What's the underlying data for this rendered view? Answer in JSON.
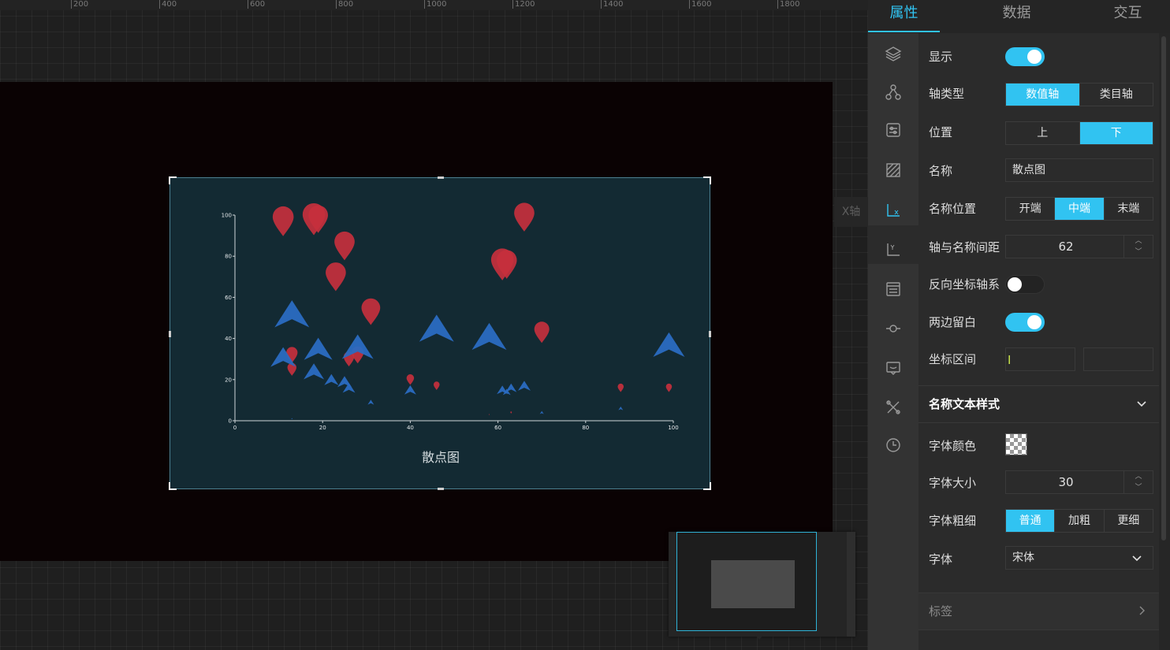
{
  "ruler": {
    "labels": [
      "200",
      "400",
      "600",
      "800",
      "1000",
      "1200",
      "1400",
      "1600",
      "1800"
    ]
  },
  "canvas": {
    "x_axis_tab_label": "X轴",
    "chart": {
      "x_axis_title": "散点图"
    }
  },
  "chart_data": {
    "type": "scatter",
    "title": "",
    "xlabel": "散点图",
    "ylabel": "",
    "xlim": [
      0,
      100
    ],
    "ylim": [
      0,
      100
    ],
    "x_ticks": [
      "0",
      "20",
      "40",
      "60",
      "80",
      "100"
    ],
    "y_ticks": [
      "0",
      "20",
      "40",
      "60",
      "80",
      "100"
    ],
    "grid": false,
    "series": [
      {
        "symbol": "pin",
        "color": "#c5303d",
        "points": [
          {
            "x": 11,
            "y": 97,
            "size": 28
          },
          {
            "x": 18,
            "y": 98,
            "size": 30
          },
          {
            "x": 19,
            "y": 98,
            "size": 26
          },
          {
            "x": 25,
            "y": 85,
            "size": 27
          },
          {
            "x": 23,
            "y": 70,
            "size": 27
          },
          {
            "x": 31,
            "y": 53,
            "size": 25
          },
          {
            "x": 13,
            "y": 32,
            "size": 15
          },
          {
            "x": 13,
            "y": 25,
            "size": 12
          },
          {
            "x": 26,
            "y": 30,
            "size": 14
          },
          {
            "x": 28,
            "y": 32,
            "size": 16
          },
          {
            "x": 40,
            "y": 20,
            "size": 10
          },
          {
            "x": 46,
            "y": 17,
            "size": 8
          },
          {
            "x": 61,
            "y": 76,
            "size": 30
          },
          {
            "x": 62,
            "y": 76,
            "size": 27
          },
          {
            "x": 66,
            "y": 99,
            "size": 27
          },
          {
            "x": 70,
            "y": 43,
            "size": 20
          },
          {
            "x": 88,
            "y": 16,
            "size": 8
          },
          {
            "x": 99,
            "y": 16,
            "size": 8
          },
          {
            "x": 63,
            "y": 4,
            "size": 2
          },
          {
            "x": 58,
            "y": 3,
            "size": 1
          }
        ]
      },
      {
        "symbol": "arrow",
        "color": "#2a6bc2",
        "points": [
          {
            "x": 13,
            "y": 52,
            "size": 44
          },
          {
            "x": 11,
            "y": 31,
            "size": 32
          },
          {
            "x": 19,
            "y": 35,
            "size": 36
          },
          {
            "x": 18,
            "y": 24,
            "size": 26
          },
          {
            "x": 22,
            "y": 20,
            "size": 18
          },
          {
            "x": 25,
            "y": 19,
            "size": 18
          },
          {
            "x": 26,
            "y": 16,
            "size": 16
          },
          {
            "x": 28,
            "y": 36,
            "size": 40
          },
          {
            "x": 46,
            "y": 45,
            "size": 44
          },
          {
            "x": 58,
            "y": 41,
            "size": 44
          },
          {
            "x": 99,
            "y": 37,
            "size": 40
          },
          {
            "x": 40,
            "y": 15,
            "size": 15
          },
          {
            "x": 61,
            "y": 15,
            "size": 14
          },
          {
            "x": 63,
            "y": 16,
            "size": 14
          },
          {
            "x": 66,
            "y": 17,
            "size": 16
          },
          {
            "x": 62,
            "y": 14,
            "size": 10
          },
          {
            "x": 31,
            "y": 9,
            "size": 8
          },
          {
            "x": 70,
            "y": 4,
            "size": 5
          },
          {
            "x": 88,
            "y": 6,
            "size": 6
          },
          {
            "x": 13,
            "y": 1,
            "size": 2
          }
        ]
      }
    ]
  },
  "panel": {
    "tabs": [
      "属性",
      "数据",
      "交互"
    ],
    "active_tab": 0,
    "rail_icons": [
      "layers-icon",
      "nodes-icon",
      "settings-card-icon",
      "hatch-icon",
      "x-axis-icon",
      "y-axis-icon",
      "list-icon",
      "node-line-icon",
      "comment-icon",
      "tools-icon",
      "clock-icon"
    ],
    "settings": {
      "show": {
        "label": "显示",
        "on": true
      },
      "axis_type": {
        "label": "轴类型",
        "options": [
          "数值轴",
          "类目轴"
        ],
        "selected": 0
      },
      "position": {
        "label": "位置",
        "options": [
          "上",
          "下"
        ],
        "selected": 1
      },
      "name": {
        "label": "名称",
        "value": "散点图"
      },
      "name_position": {
        "label": "名称位置",
        "options": [
          "开端",
          "中端",
          "末端"
        ],
        "selected": 1
      },
      "name_gap": {
        "label": "轴与名称间距",
        "value": "62"
      },
      "inverse": {
        "label": "反向坐标轴系",
        "on": false
      },
      "boundary_gap": {
        "label": "两边留白",
        "on": true
      },
      "range": {
        "label": "坐标区间",
        "min": "",
        "max": ""
      },
      "name_text_style": {
        "title": "名称文本样式",
        "font_color": {
          "label": "字体颜色"
        },
        "font_size": {
          "label": "字体大小",
          "value": "30"
        },
        "font_weight": {
          "label": "字体粗细",
          "options": [
            "普通",
            "加粗",
            "更细"
          ],
          "selected": 0
        },
        "font_family": {
          "label": "字体",
          "value": "宋体"
        }
      },
      "labels_section": {
        "title": "标签"
      }
    }
  },
  "colors": {
    "accent": "#31c3f1",
    "stage": "#0a0203",
    "chart_bg": "#132a33",
    "pin": "#c5303d",
    "arrow": "#2a6bc2"
  }
}
